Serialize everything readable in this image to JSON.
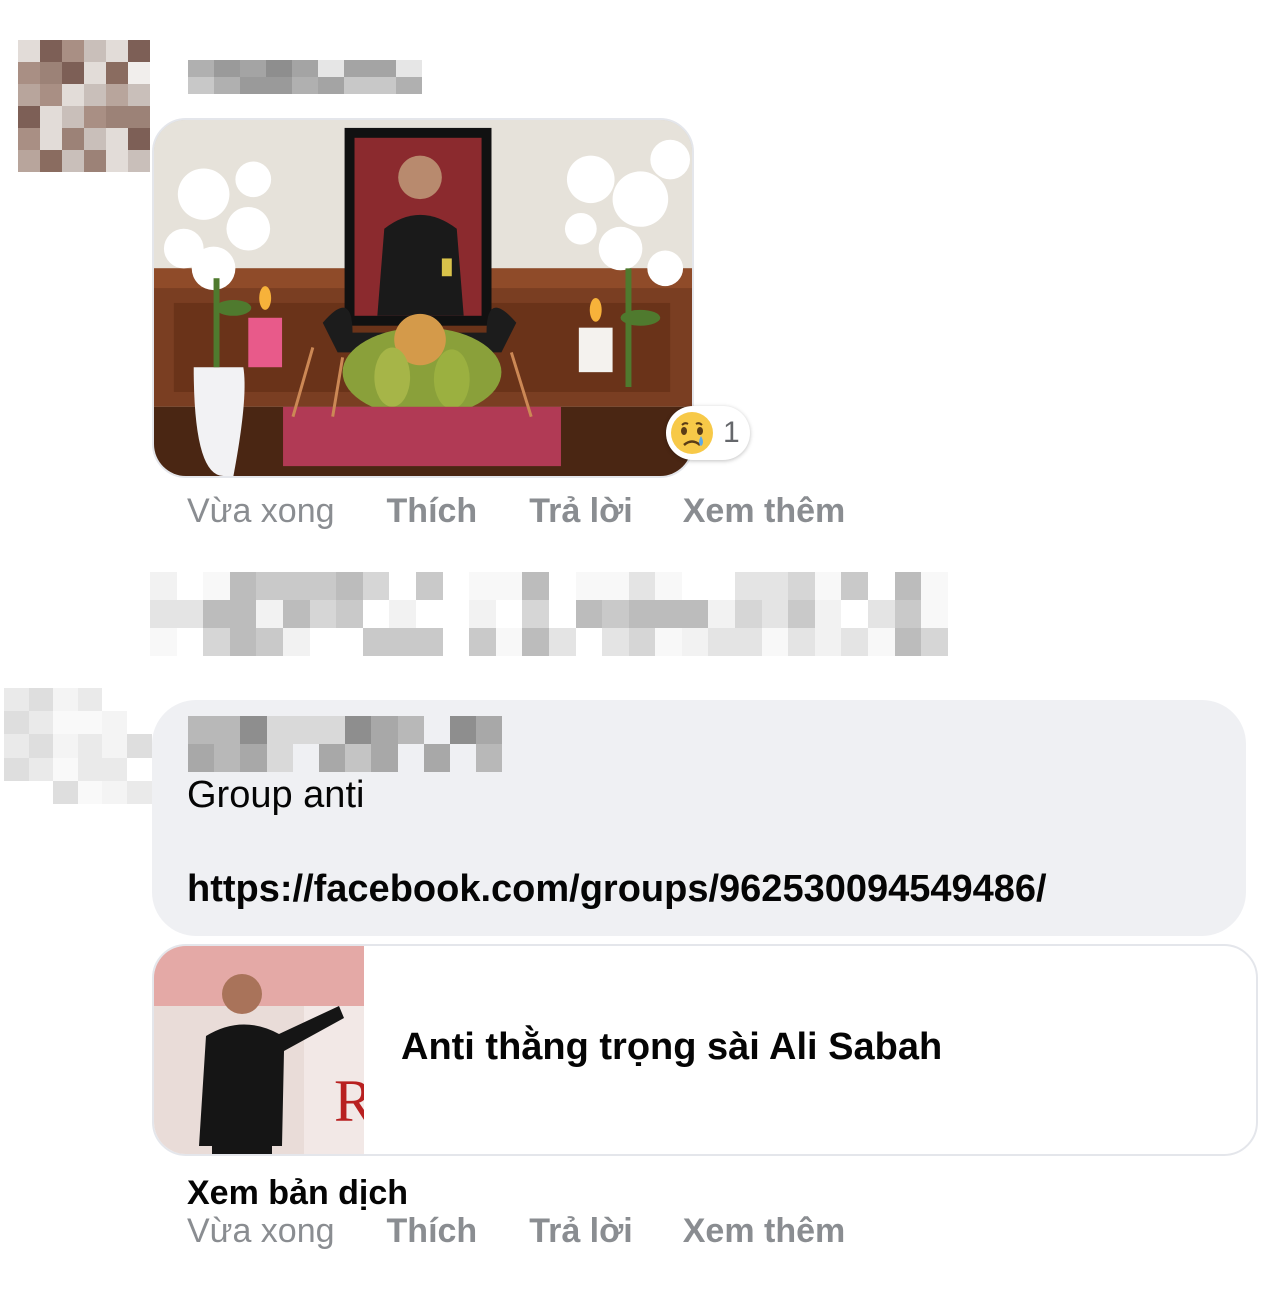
{
  "comments": [
    {
      "author_name_blurred": true,
      "attachment": "photo-altar-referee",
      "reaction": {
        "icon": "crying-face-icon",
        "count": "1"
      },
      "actions": {
        "time": "Vừa xong",
        "like": "Thích",
        "reply": "Trả lời",
        "more": "Xem thêm"
      }
    },
    {
      "author_name_blurred": true,
      "message_line1": "Group anti",
      "message_link": "https://facebook.com/groups/962530094549486/",
      "link_preview": {
        "title": "Anti thằng trọng sài Ali Sabah",
        "thumbnail": "referee-thumbnail"
      },
      "translate_label": "Xem bản dịch",
      "actions": {
        "time": "Vừa xong",
        "like": "Thích",
        "reply": "Trả lời",
        "more": "Xem thêm"
      }
    }
  ],
  "colors": {
    "bubble_bg": "#eff0f3",
    "secondary_text": "#8a8d91",
    "primary_text": "#050505"
  }
}
